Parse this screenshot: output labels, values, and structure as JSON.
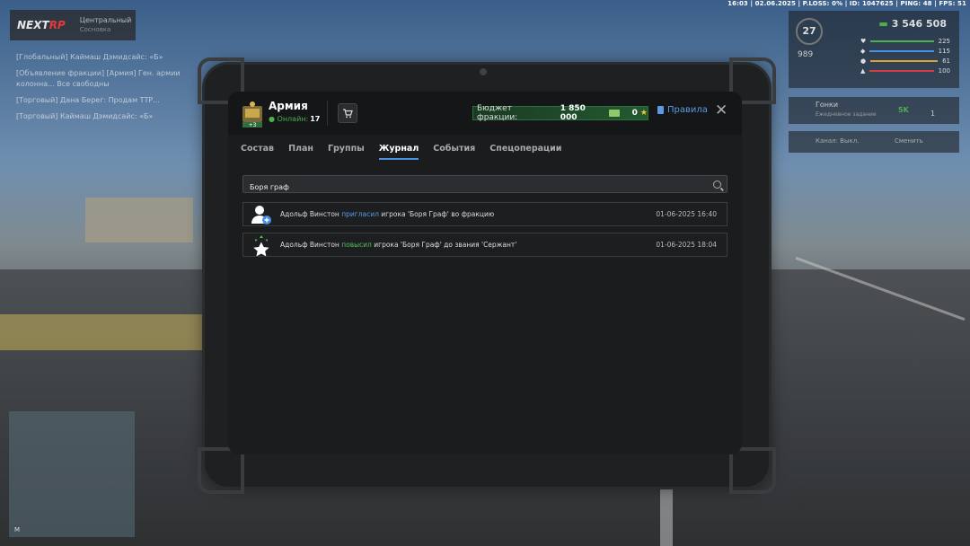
{
  "topbar": {
    "text": "16:03 | 02.06.2025 | P.LOSS: 0% | ID: 1047625 | PING: 48 | FPS: 51"
  },
  "logo": {
    "brand_a": "NEXT",
    "brand_b": "RP",
    "city": "Центральный",
    "city_sub": "Сосновка"
  },
  "chat": [
    "[Глобальный] Каймаш Дэмидсайс: «Б»",
    "[Объявление фракции] [Армия] Ген. армии колонна... Все свободны",
    "[Торговый] Дана Берег: Продам ТТР...",
    "[Торговый] Каймаш Дэмидсайс: «Б»"
  ],
  "hud": {
    "level": "27",
    "money": "3 546 508",
    "side_value": "989",
    "stats": [
      "225",
      "115",
      "61",
      "100"
    ],
    "stat_extra": "100",
    "event": "Гонки",
    "event_sub": "Ежедневное задание",
    "event_reward": "5K",
    "event_count": "1",
    "channel": "Канал: Выкл.",
    "mic": "Сменить"
  },
  "minimap": {
    "label": "M"
  },
  "faction": {
    "name": "Армия",
    "online_label": "Онлайн:",
    "online_count": "17",
    "icon_badge": "+3"
  },
  "budget": {
    "label": "Бюджет фракции:",
    "amount": "1 850 000",
    "coins": "0"
  },
  "rules_label": "Правила",
  "close_label": "✕",
  "tabs": [
    "Состав",
    "План",
    "Группы",
    "Журнал",
    "События",
    "Спецоперации"
  ],
  "active_tab": "Журнал",
  "search": {
    "value": "Боря граф",
    "placeholder": ""
  },
  "log": [
    {
      "icon": "user-add-icon",
      "actor": "Адольф Винстон",
      "action": "пригласил",
      "rest": "игрока 'Боря Граф' во фракцию",
      "date": "01-06-2025 16:40"
    },
    {
      "icon": "promote-icon",
      "actor": "Адольф Винстон",
      "action": "повысил",
      "rest": "игрока 'Боря Граф' до звания 'Сержант'",
      "date": "01-06-2025 18:04"
    }
  ],
  "colors": {
    "accent_blue": "#5b9be6",
    "accent_green": "#52c05a",
    "budget_bg": "#235a30",
    "screen_bg": "#1b1c1e"
  }
}
